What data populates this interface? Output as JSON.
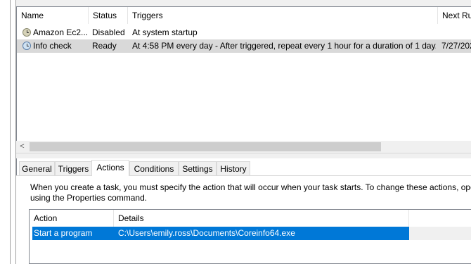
{
  "task_list": {
    "columns": [
      "Name",
      "Status",
      "Triggers",
      "Next Ru"
    ],
    "rows": [
      {
        "name": "Amazon Ec2...",
        "status": "Disabled",
        "triggers": "At system startup",
        "next_run": ""
      },
      {
        "name": "Info check",
        "status": "Ready",
        "triggers": "At 4:58 PM every day - After triggered, repeat every 1 hour for a duration of 1 day.",
        "next_run": "7/27/202"
      }
    ],
    "icon": "clock-icon",
    "scroll_left_glyph": "<"
  },
  "tabs": [
    "General",
    "Triggers",
    "Actions",
    "Conditions",
    "Settings",
    "History"
  ],
  "active_tab": "Actions",
  "actions_tab": {
    "description_line1": "When you create a task, you must specify the action that will occur when your task starts.  To change these actions, ope",
    "description_line2": "using the Properties command.",
    "columns": [
      "Action",
      "Details"
    ],
    "rows": [
      {
        "action": "Start a program",
        "details": "C:\\Users\\emily.ross\\Documents\\Coreinfo64.exe"
      }
    ]
  },
  "colors": {
    "selection": "#0078d7",
    "row_highlight": "#d9d9d9",
    "clock_face_1": "#c8c8a8",
    "clock_face_2": "#a8c8e8"
  }
}
